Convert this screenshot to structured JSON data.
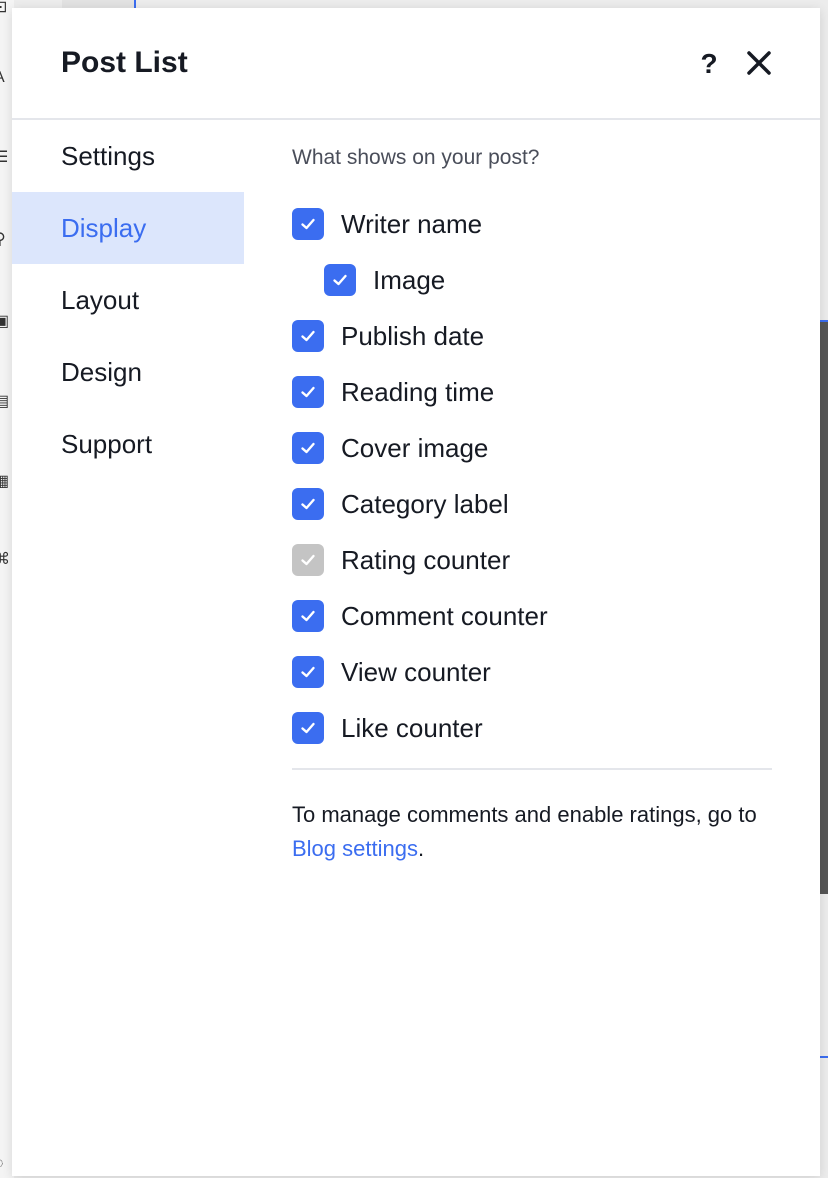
{
  "panel": {
    "title": "Post List",
    "help_label": "?",
    "close_label": "close"
  },
  "nav": {
    "items": [
      {
        "label": "Settings",
        "active": false
      },
      {
        "label": "Display",
        "active": true
      },
      {
        "label": "Layout",
        "active": false
      },
      {
        "label": "Design",
        "active": false
      },
      {
        "label": "Support",
        "active": false
      }
    ]
  },
  "display": {
    "section_label": "What shows on your post?",
    "options": [
      {
        "label": "Writer name",
        "checked": true,
        "disabled": false,
        "indent": false
      },
      {
        "label": "Image",
        "checked": true,
        "disabled": false,
        "indent": true
      },
      {
        "label": "Publish date",
        "checked": true,
        "disabled": false,
        "indent": false
      },
      {
        "label": "Reading time",
        "checked": true,
        "disabled": false,
        "indent": false
      },
      {
        "label": "Cover image",
        "checked": true,
        "disabled": false,
        "indent": false
      },
      {
        "label": "Category label",
        "checked": true,
        "disabled": false,
        "indent": false
      },
      {
        "label": "Rating counter",
        "checked": true,
        "disabled": true,
        "indent": false
      },
      {
        "label": "Comment counter",
        "checked": true,
        "disabled": false,
        "indent": false
      },
      {
        "label": "View counter",
        "checked": true,
        "disabled": false,
        "indent": false
      },
      {
        "label": "Like counter",
        "checked": true,
        "disabled": false,
        "indent": false
      }
    ],
    "footnote_text": "To manage comments and enable ratings, go to ",
    "footnote_link": "Blog settings",
    "footnote_end": "."
  },
  "colors": {
    "accent": "#3b6df0",
    "active_nav_bg": "#dce6fc",
    "disabled_checkbox": "#c4c4c4",
    "text": "#161a23"
  }
}
